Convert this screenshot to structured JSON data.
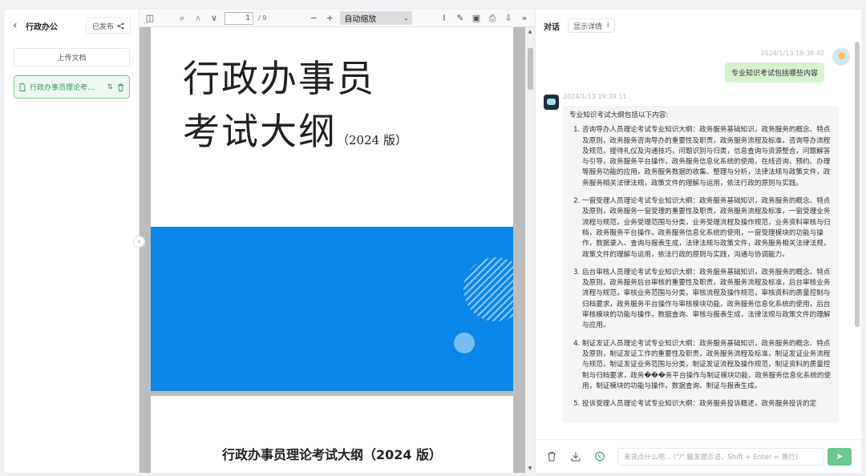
{
  "left": {
    "title": "行政办公",
    "published_label": "已发布",
    "upload_label": "上传文档",
    "doc_name": "行政办事员理论考…"
  },
  "viewer": {
    "page_current": "1",
    "page_total": "/ 9",
    "zoom_label": "自动缩放",
    "page1_title_line1": "行政办事员",
    "page1_title_line2": "考试大纲",
    "page1_year": "（2024 版）",
    "page2_title": "行政办事员理论考试大纲（2024 版）",
    "band_color": "#0a87e8"
  },
  "chat": {
    "title": "对话",
    "detail_label": "显示详情",
    "user_time": "2024/1/13 19:38:42",
    "user_message": "专业知识考试包括哪些内容",
    "bot_time": "2024/1/13 19:39:11",
    "bot_intro": "专业知识考试大纲包括以下内容:",
    "bot_items": [
      "咨询导办人员理论考试专业知识大纲：政务服务基础知识，政务服务的概念、特点及原则，政务服务咨询导办的重要性及职责，政务服务流程及标准，咨询导办流程及规范，接待礼仪及沟通技巧，问题识别与归类，信息查询与资源整合，问题解答与引导，政务服务平台操作，政务服务信息化系统的使用，在线咨询、预约、办理等服务功能的应用，政务服务数据的收集、整理与分析，法律法规与政策文件，政务服务相关法律法规，政策文件的理解与运用，依法行政的原则与实践。",
      "一窗受理人员理论考试专业知识大纲：政务服务基础知识，政务服务的概念、特点及原则，政务服务一窗受理的重要性及职责，政务服务流程及标准，一窗受理业务流程与规范，业务受理范围与分类，业务受理流程及操作规范，业务资料审核与归档，政务服务平台操作，政务服务信息化系统的使用，一窗受理模块的功能与操作，数据录入、查询与报表生成，法律法规与政策文件，政务服务相关法律法规，政策文件的理解与运用，依法行政的原则与实践，沟通与协调能力。",
      "后台审核人员理论考试专业知识大纲：政务服务基础知识，政务服务的概念、特点及原则，政务服务后台审核的重要性及职责，政务服务流程及标准，后台审核业务流程与规范，审核业务范围与分类，审核流程及操作规范，审核资料的质量控制与归档要求，政务服务平台操作与审核模块功能，政务服务信息化系统的使用，后台审核模块的功能与操作，数据查询、审核与报表生成，法律法规与政策文件的理解与应用。",
      "制证发证人员理论考试专业知识大纲：政务服务基础知识，政务服务的概念、特点及原则，制证发证工作的重要性及职责，政务服务流程及标准，制证发证业务流程与规范，制证发证业务范围与分类，制证发证流程及操作规范，制证资料的质量控制与归档要求，政务���务平台操作与制证模块功能，政务服务信息化系统的使用，制证模块的功能与操作，数据查询、制证与报表生成。",
      "投诉受理人员理论考试专业知识大纲：政务服务投诉概述，政务服务投诉的定"
    ],
    "input_placeholder": "来说点什么吧... (\"/\" 触发提示语，Shift + Enter = 换行)",
    "accent": "#2f9e5b"
  }
}
